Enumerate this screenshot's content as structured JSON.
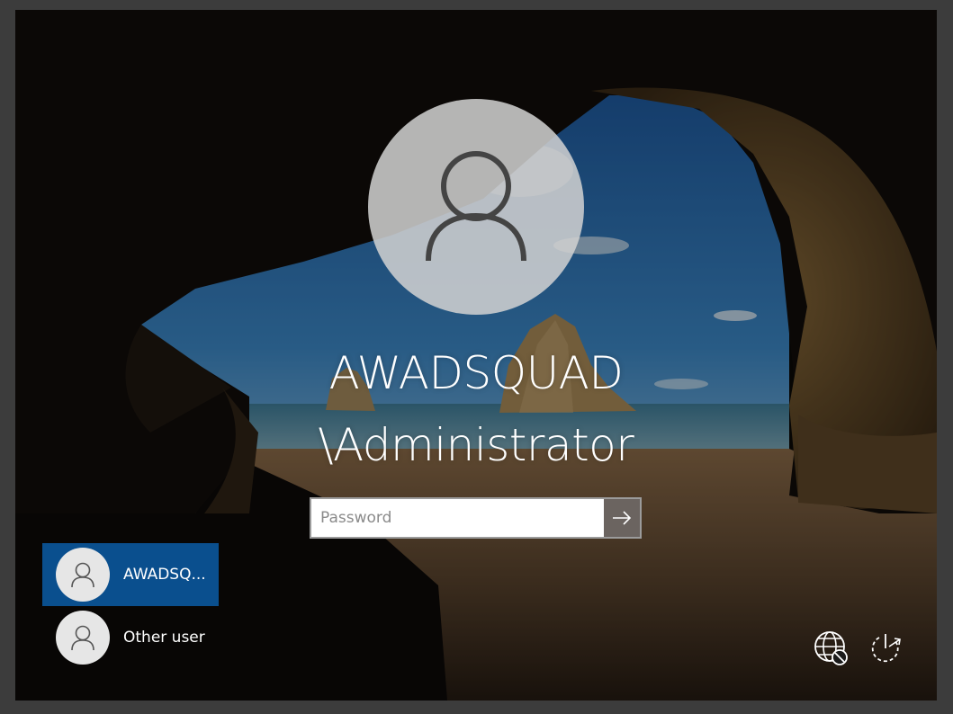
{
  "login": {
    "username_line1": "AWADSQUAD",
    "username_line2": "\\Administrator",
    "password_placeholder": "Password",
    "password_value": ""
  },
  "user_list": [
    {
      "label": "AWADSQ...",
      "selected": true
    },
    {
      "label": "Other user",
      "selected": false
    }
  ],
  "icons": {
    "avatar": "person-icon",
    "submit": "arrow-right-icon",
    "network": "network-disconnected-icon",
    "power": "power-icon"
  },
  "colors": {
    "selected_tile": "#0a4f8e",
    "submit_button": "#6b6460"
  }
}
